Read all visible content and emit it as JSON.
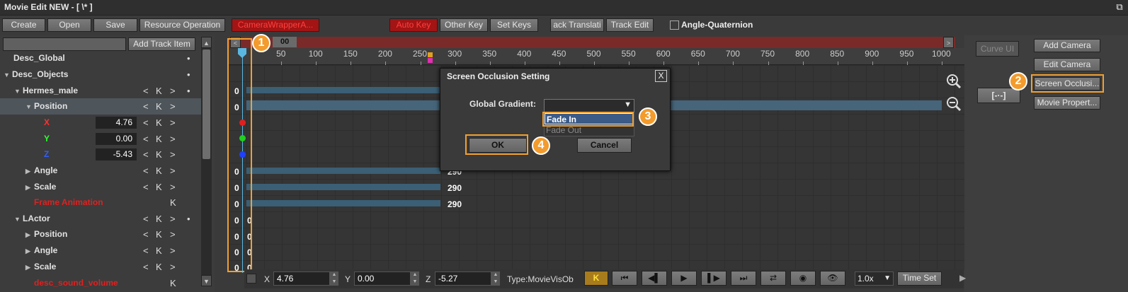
{
  "window": {
    "title": "Movie Edit NEW - [ \\* ]"
  },
  "toolbar": {
    "create": "Create",
    "open": "Open",
    "save": "Save",
    "resource_operation": "Resource Operation",
    "camera_wrapper": "CameraWrapperA...",
    "auto_key": "Auto Key",
    "other_key": "Other Key",
    "set_keys": "Set Keys",
    "track_translation": "ack Translati",
    "track_edit": "Track Edit",
    "angle_quaternion": "Angle-Quaternion"
  },
  "left": {
    "add_track_item": "Add Track Item",
    "rows": [
      {
        "label": "Desc_Global"
      },
      {
        "label": "Desc_Objects"
      },
      {
        "label": "Hermes_male"
      },
      {
        "label": "Position"
      },
      {
        "label": "X",
        "value": "4.76"
      },
      {
        "label": "Y",
        "value": "0.00"
      },
      {
        "label": "Z",
        "value": "-5.43"
      },
      {
        "label": "Angle"
      },
      {
        "label": "Scale"
      },
      {
        "label": "Frame Animation"
      },
      {
        "label": "LActor"
      },
      {
        "label": "Position"
      },
      {
        "label": "Angle"
      },
      {
        "label": "Scale"
      },
      {
        "label": "desc_sound_volume"
      }
    ],
    "ctl_prev": "<",
    "ctl_k": "K",
    "ctl_next": ">",
    "bullet": "•"
  },
  "timeline": {
    "frame_box": "00",
    "nav_left": "<",
    "nav_right": ">",
    "ticks": [
      "50",
      "100",
      "150",
      "200",
      "250",
      "300",
      "350",
      "400",
      "450",
      "500",
      "550",
      "600",
      "650",
      "700",
      "750",
      "800",
      "850",
      "900",
      "950",
      "1000"
    ],
    "zero": "0",
    "end_labels": [
      "290",
      "290",
      "290"
    ]
  },
  "dialog": {
    "title": "Screen Occlusion Setting",
    "close": "X",
    "gradient_label": "Global Gradient:",
    "options": [
      "Fade In",
      "Fade Out"
    ],
    "ok": "OK",
    "cancel": "Cancel"
  },
  "right": {
    "curve_ui": "Curve UI",
    "add_camera": "Add Camera",
    "edit_camera": "Edit Camera",
    "screen_occlusion": "Screen Occlusi...",
    "movie_property": "Movie Propert...",
    "frame_icon": "[-·-]"
  },
  "bottom": {
    "x_label": "X",
    "x_value": "4.76",
    "y_label": "Y",
    "y_value": "0.00",
    "z_label": "Z",
    "z_value": "-5.27",
    "type": "Type:MovieVisOb",
    "speed": "1.0x",
    "time_set": "Time Set"
  },
  "badges": [
    "1",
    "2",
    "3",
    "4"
  ],
  "colors": {
    "highlight": "#f0a030",
    "red": "#ff3030",
    "accent": "#3b5f75"
  }
}
